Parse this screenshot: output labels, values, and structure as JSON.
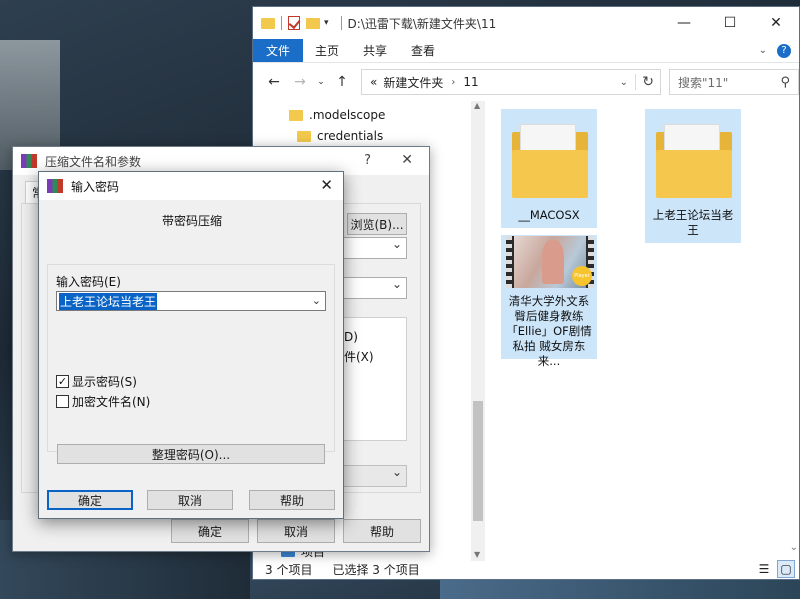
{
  "explorer": {
    "title_path": "D:\\迅雷下载\\新建文件夹\\11",
    "window_buttons": [
      "—",
      "☐",
      "✕"
    ],
    "ribbon_tabs": [
      "文件",
      "主页",
      "共享",
      "查看"
    ],
    "address": {
      "prefix": "«",
      "crumbs": [
        "新建文件夹",
        "11"
      ]
    },
    "search_placeholder": "搜索\"11\"",
    "tree_items": [
      ".modelscope",
      "credentials",
      "项目"
    ],
    "items": [
      {
        "label": "__MACOSX",
        "kind": "folder"
      },
      {
        "label": "上老王论坛当老王",
        "kind": "folder"
      },
      {
        "label": "清华大学外文系臀后健身教练「Ellie」OF剧情私拍 贼女房东来...",
        "kind": "video",
        "badge": "Player"
      }
    ],
    "status_count": "3 个项目",
    "status_selected": "已选择 3 个项目"
  },
  "params_dialog": {
    "title": "压缩文件名和参数",
    "help": "?",
    "close": "✕",
    "tab": "常规",
    "browse_label": "浏览(B)...",
    "option_d": "D)",
    "option_x": "件(X)",
    "ok": "确定",
    "cancel": "取消",
    "help_button": "帮助"
  },
  "password_dialog": {
    "title": "输入密码",
    "close": "✕",
    "subtitle": "带密码压缩",
    "label": "输入密码(E)",
    "password_value": "上老王论坛当老王",
    "show_password": {
      "label": "显示密码(S)",
      "checked": true
    },
    "encrypt_names": {
      "label": "加密文件名(N)",
      "checked": false
    },
    "organize_label": "整理密码(O)...",
    "ok": "确定",
    "cancel": "取消",
    "help": "帮助"
  }
}
